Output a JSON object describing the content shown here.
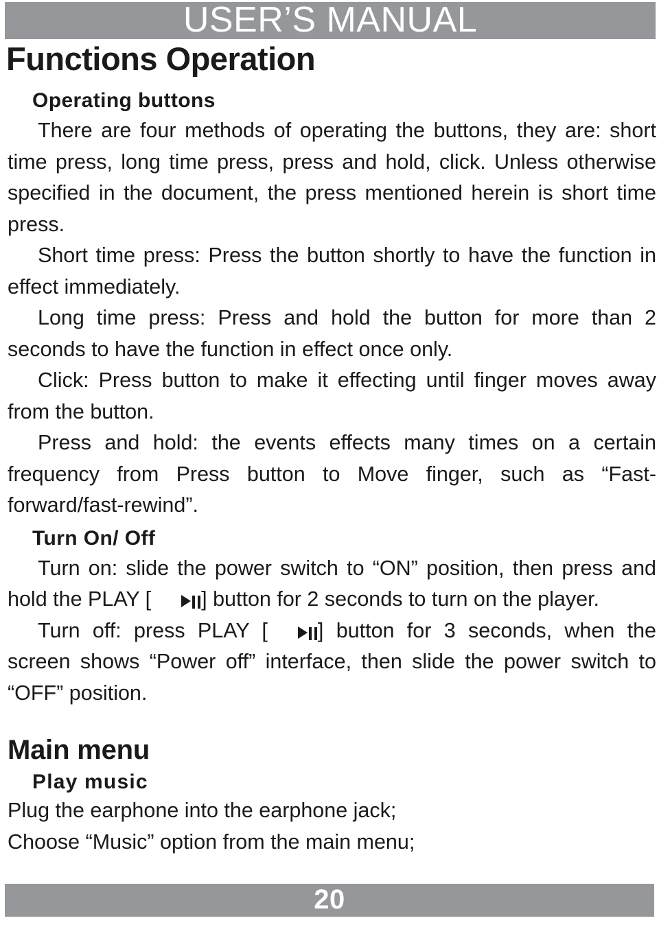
{
  "header": {
    "banner_title": "USER’S MANUAL",
    "banner_color": "#95979a",
    "banner_text_color": "#ffffff"
  },
  "chapter": {
    "title": "Functions Operation"
  },
  "sections": {
    "operating_buttons": {
      "heading": "Operating buttons",
      "paragraphs": [
        "There are four methods of operating the buttons, they are: short time press, long time press, press and hold, click. Unless otherwise specified in the document, the press mentioned herein is short time press.",
        "Short time press: Press the button shortly to have the function in effect immediately.",
        "Long time press: Press and hold the button for more than 2 seconds to have the function in effect once only.",
        "Click: Press button to make it effecting until finger moves away from the button.",
        "Press and hold: the events effects many times on a certain frequency from Press button to Move finger, such as “Fast-forward/fast-rewind”."
      ]
    },
    "turn_on_off": {
      "heading": "Turn On/ Off",
      "turn_on_before_icon": "Turn on: slide the power switch to “ON” position, then press and hold the PLAY [",
      "turn_on_after_icon": "] button for 2 seconds to turn on the player.",
      "turn_off_before_icon": "Turn off: press PLAY [",
      "turn_off_after_icon": "] button for 3 seconds, when the screen shows “Power off” interface, then slide the power switch to “OFF” position.",
      "play_pause_icon": "play-pause"
    },
    "main_menu": {
      "heading": "Main menu",
      "sub_heading": "Play music",
      "paragraphs": [
        "Plug the earphone into the earphone jack;",
        "Choose “Music” option from the main menu;"
      ]
    }
  },
  "footer": {
    "page_number": "20",
    "band_color": "#95979a",
    "text_color": "#ffffff"
  }
}
